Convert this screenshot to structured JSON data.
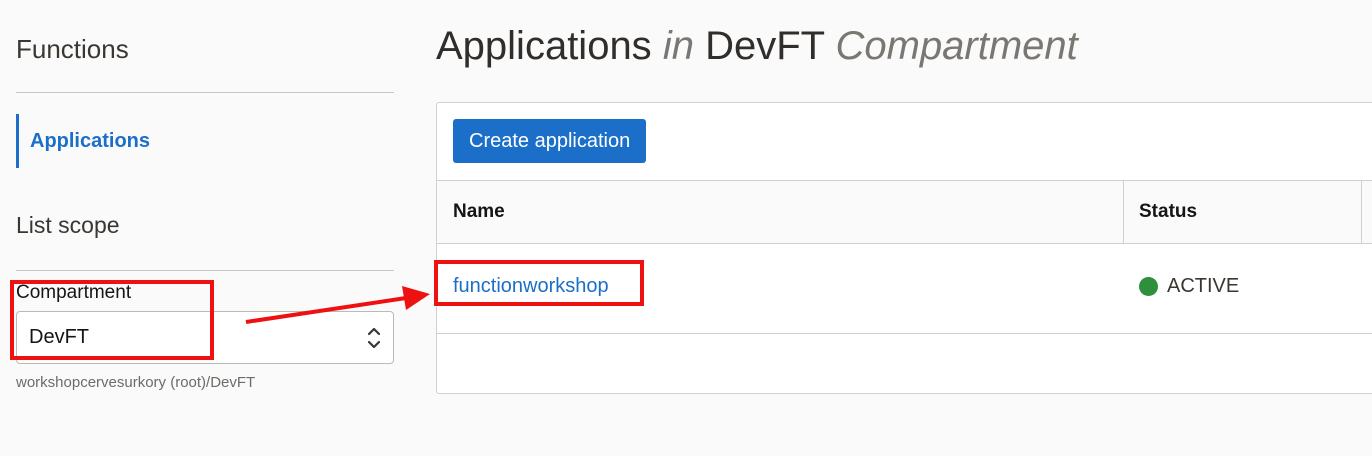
{
  "sidebar": {
    "title": "Functions",
    "nav_active": "Applications",
    "list_scope": "List scope",
    "compartment_label": "Compartment",
    "compartment_value": "DevFT",
    "compartment_path": "workshopcervesurkory (root)/DevFT"
  },
  "header": {
    "title_part1": "Applications",
    "title_in": "in",
    "title_compartment": "DevFT",
    "title_suffix": "Compartment"
  },
  "toolbar": {
    "create_label": "Create application"
  },
  "table": {
    "columns": [
      "Name",
      "Status"
    ],
    "rows": [
      {
        "name": "functionworkshop",
        "status": "ACTIVE",
        "status_color": "#2f8f3b"
      }
    ]
  },
  "annotations": {
    "highlight_color": "#ee1111"
  }
}
